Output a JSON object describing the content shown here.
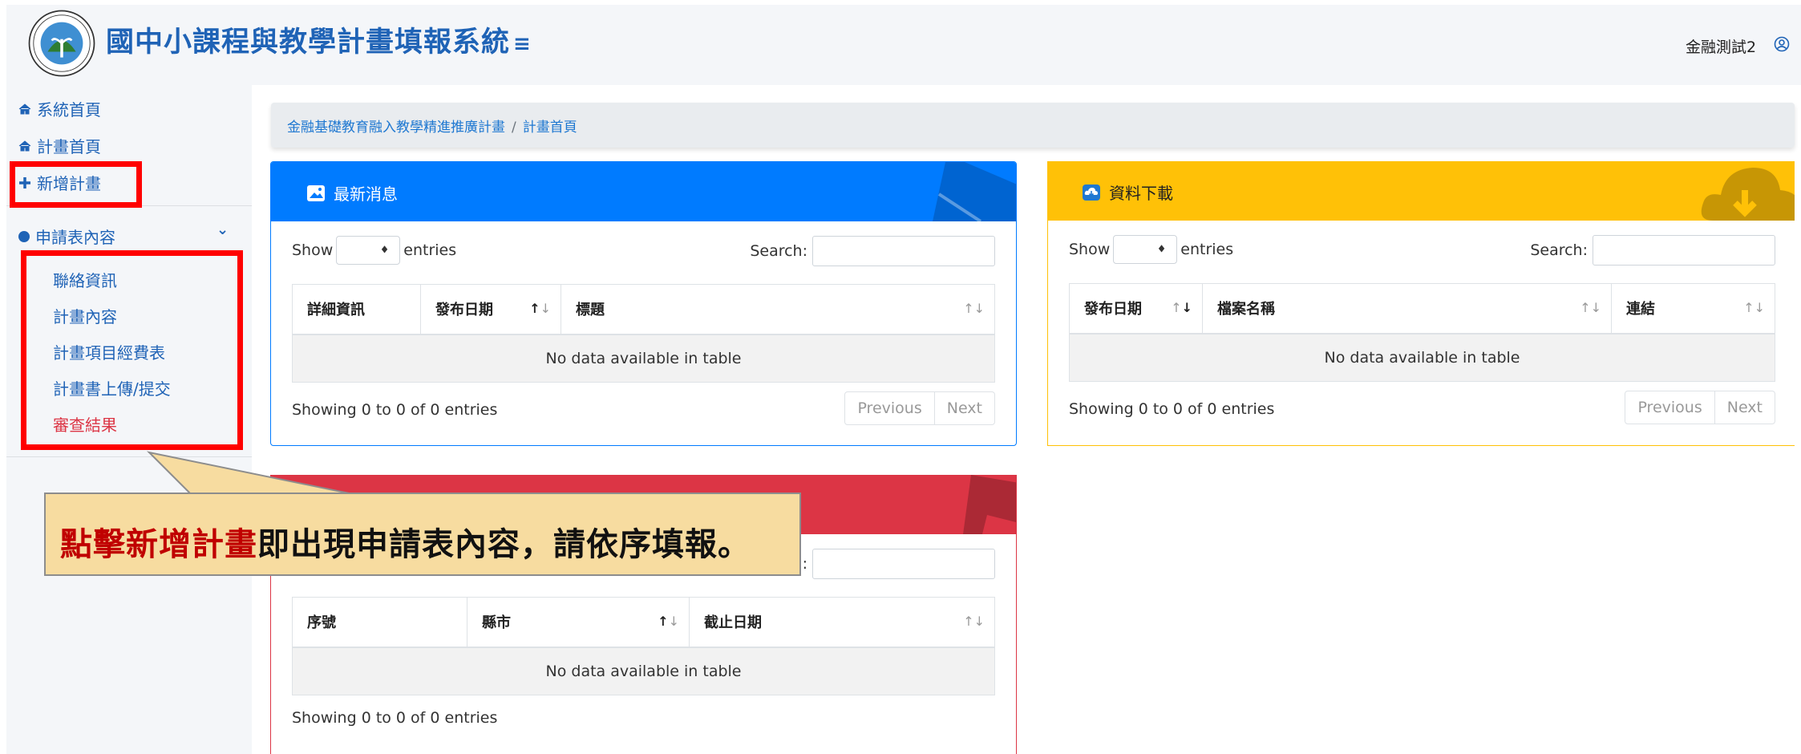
{
  "header": {
    "app_title": "國中小課程與教學計畫填報系統",
    "menu_toggle": "≡",
    "user_name": "金融測試2"
  },
  "sidebar": {
    "items": [
      {
        "label": "系統首頁",
        "icon": "home-icon"
      },
      {
        "label": "計畫首頁",
        "icon": "home-icon"
      },
      {
        "label": "新增計畫",
        "icon": "plus-icon"
      }
    ],
    "section": {
      "label": "申請表內容",
      "icon": "circle-icon",
      "chevron": "⌄"
    },
    "sub_items": [
      {
        "label": "聯絡資訊",
        "icon": "contact-card-icon"
      },
      {
        "label": "計畫內容",
        "icon": "edit-icon"
      },
      {
        "label": "計畫項目經費表",
        "icon": "money-icon"
      },
      {
        "label": "計畫書上傳/提交",
        "icon": "upload-users-icon"
      },
      {
        "label": "審查結果",
        "icon": "review-icon"
      }
    ]
  },
  "breadcrumb": {
    "items": [
      "金融基礎教育融入教學精進推廣計畫",
      "計畫首頁"
    ],
    "separator": "/"
  },
  "news_card": {
    "title": "最新消息",
    "show_label": "Show",
    "entries_label": "entries",
    "search_label": "Search:",
    "columns": [
      "詳細資訊",
      "發布日期",
      "標題"
    ],
    "empty": "No data available in table",
    "info": "Showing 0 to 0 of 0 entries",
    "prev": "Previous",
    "next": "Next"
  },
  "download_card": {
    "title": "資料下載",
    "show_label": "Show",
    "entries_label": "entries",
    "search_label": "Search:",
    "columns": [
      "發布日期",
      "檔案名稱",
      "連結"
    ],
    "empty": "No data available in table",
    "info": "Showing 0 to 0 of 0 entries",
    "prev": "Previous",
    "next": "Next"
  },
  "deadline_card": {
    "search_label": ":",
    "columns": [
      "序號",
      "縣市",
      "截止日期"
    ],
    "empty": "No data available in table",
    "info": "Showing 0 to 0 of 0 entries"
  },
  "callout": {
    "highlight": "點擊新增計畫",
    "text": "即出現申請表內容，請依序填報。"
  },
  "colors": {
    "primary": "#007bff",
    "warning": "#ffc107",
    "danger": "#dc3545",
    "link": "#1f63b6",
    "annotation_red": "#ff0000",
    "callout_bg": "#f7dca0"
  }
}
